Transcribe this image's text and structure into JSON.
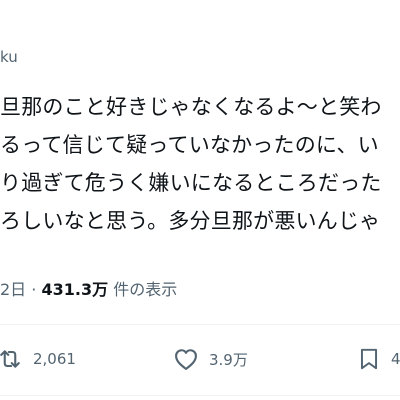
{
  "header": {
    "handle": "ku"
  },
  "tweet": {
    "lines": [
      "旦那のこと好きじゃなくなるよ〜と笑わ",
      "るって信じて疑っていなかったのに、い",
      "り過ぎて危うく嫌いになるところだった",
      "ろしいなと思う。多分旦那が悪いんじゃ"
    ]
  },
  "meta": {
    "date": "2日",
    "separator": "·",
    "views": "431.3万",
    "views_label": "件の表示"
  },
  "actions": {
    "retweet": {
      "icon": "retweet-icon",
      "count": "2,061"
    },
    "like": {
      "icon": "heart-icon",
      "count": "3.9万"
    },
    "bookmark": {
      "icon": "bookmark-icon",
      "count": "4"
    }
  },
  "colors": {
    "text": "#0f1419",
    "secondary": "#536471",
    "divider": "#eff3f4"
  }
}
